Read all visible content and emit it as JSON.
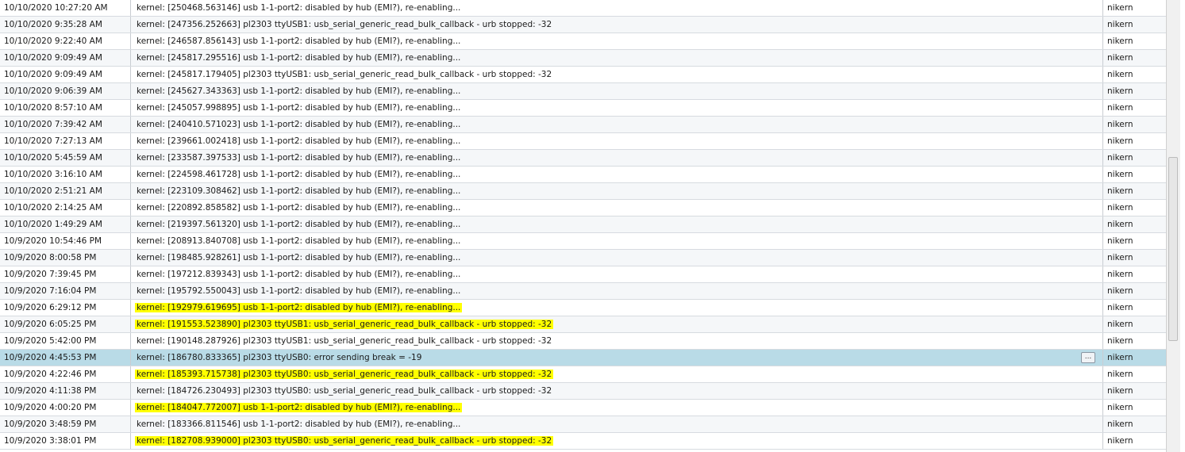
{
  "log": {
    "rows": [
      {
        "time": "10/10/2020 10:27:20 AM",
        "message": "kernel: [250468.563146] usb 1-1-port2: disabled by hub (EMI?), re-enabling...",
        "host": "nikern",
        "highlight": false
      },
      {
        "time": "10/10/2020 9:35:28 AM",
        "message": "kernel: [247356.252663] pl2303 ttyUSB1: usb_serial_generic_read_bulk_callback - urb stopped: -32",
        "host": "nikern",
        "highlight": false
      },
      {
        "time": "10/10/2020 9:22:40 AM",
        "message": "kernel: [246587.856143] usb 1-1-port2: disabled by hub (EMI?), re-enabling...",
        "host": "nikern",
        "highlight": false
      },
      {
        "time": "10/10/2020 9:09:49 AM",
        "message": "kernel: [245817.295516] usb 1-1-port2: disabled by hub (EMI?), re-enabling...",
        "host": "nikern",
        "highlight": false
      },
      {
        "time": "10/10/2020 9:09:49 AM",
        "message": "kernel: [245817.179405] pl2303 ttyUSB1: usb_serial_generic_read_bulk_callback - urb stopped: -32",
        "host": "nikern",
        "highlight": false
      },
      {
        "time": "10/10/2020 9:06:39 AM",
        "message": "kernel: [245627.343363] usb 1-1-port2: disabled by hub (EMI?), re-enabling...",
        "host": "nikern",
        "highlight": false
      },
      {
        "time": "10/10/2020 8:57:10 AM",
        "message": "kernel: [245057.998895] usb 1-1-port2: disabled by hub (EMI?), re-enabling...",
        "host": "nikern",
        "highlight": false
      },
      {
        "time": "10/10/2020 7:39:42 AM",
        "message": "kernel: [240410.571023] usb 1-1-port2: disabled by hub (EMI?), re-enabling...",
        "host": "nikern",
        "highlight": false
      },
      {
        "time": "10/10/2020 7:27:13 AM",
        "message": "kernel: [239661.002418] usb 1-1-port2: disabled by hub (EMI?), re-enabling...",
        "host": "nikern",
        "highlight": false
      },
      {
        "time": "10/10/2020 5:45:59 AM",
        "message": "kernel: [233587.397533] usb 1-1-port2: disabled by hub (EMI?), re-enabling...",
        "host": "nikern",
        "highlight": false
      },
      {
        "time": "10/10/2020 3:16:10 AM",
        "message": "kernel: [224598.461728] usb 1-1-port2: disabled by hub (EMI?), re-enabling...",
        "host": "nikern",
        "highlight": false
      },
      {
        "time": "10/10/2020 2:51:21 AM",
        "message": "kernel: [223109.308462] usb 1-1-port2: disabled by hub (EMI?), re-enabling...",
        "host": "nikern",
        "highlight": false
      },
      {
        "time": "10/10/2020 2:14:25 AM",
        "message": "kernel: [220892.858582] usb 1-1-port2: disabled by hub (EMI?), re-enabling...",
        "host": "nikern",
        "highlight": false
      },
      {
        "time": "10/10/2020 1:49:29 AM",
        "message": "kernel: [219397.561320] usb 1-1-port2: disabled by hub (EMI?), re-enabling...",
        "host": "nikern",
        "highlight": false
      },
      {
        "time": "10/9/2020 10:54:46 PM",
        "message": "kernel: [208913.840708] usb 1-1-port2: disabled by hub (EMI?), re-enabling...",
        "host": "nikern",
        "highlight": false
      },
      {
        "time": "10/9/2020 8:00:58 PM",
        "message": "kernel: [198485.928261] usb 1-1-port2: disabled by hub (EMI?), re-enabling...",
        "host": "nikern",
        "highlight": false
      },
      {
        "time": "10/9/2020 7:39:45 PM",
        "message": "kernel: [197212.839343] usb 1-1-port2: disabled by hub (EMI?), re-enabling...",
        "host": "nikern",
        "highlight": false
      },
      {
        "time": "10/9/2020 7:16:04 PM",
        "message": "kernel: [195792.550043] usb 1-1-port2: disabled by hub (EMI?), re-enabling...",
        "host": "nikern",
        "highlight": false
      },
      {
        "time": "10/9/2020 6:29:12 PM",
        "message": "kernel: [192979.619695] usb 1-1-port2: disabled by hub (EMI?), re-enabling...",
        "host": "nikern",
        "highlight": true
      },
      {
        "time": "10/9/2020 6:05:25 PM",
        "message": "kernel: [191553.523890] pl2303 ttyUSB1: usb_serial_generic_read_bulk_callback - urb stopped: -32",
        "host": "nikern",
        "highlight": true
      },
      {
        "time": "10/9/2020 5:42:00 PM",
        "message": "kernel: [190148.287926] pl2303 ttyUSB1: usb_serial_generic_read_bulk_callback - urb stopped: -32",
        "host": "nikern",
        "highlight": false
      },
      {
        "time": "10/9/2020 4:45:53 PM",
        "message": "kernel: [186780.833365] pl2303 ttyUSB0: error sending break = -19",
        "host": "nikern",
        "highlight": false,
        "selected": true
      },
      {
        "time": "10/9/2020 4:22:46 PM",
        "message": "kernel: [185393.715738] pl2303 ttyUSB0: usb_serial_generic_read_bulk_callback - urb stopped: -32",
        "host": "nikern",
        "highlight": true
      },
      {
        "time": "10/9/2020 4:11:38 PM",
        "message": "kernel: [184726.230493] pl2303 ttyUSB0: usb_serial_generic_read_bulk_callback - urb stopped: -32",
        "host": "nikern",
        "highlight": false
      },
      {
        "time": "10/9/2020 4:00:20 PM",
        "message": "kernel: [184047.772007] usb 1-1-port2: disabled by hub (EMI?), re-enabling...",
        "host": "nikern",
        "highlight": true
      },
      {
        "time": "10/9/2020 3:48:59 PM",
        "message": "kernel: [183366.811546] usb 1-1-port2: disabled by hub (EMI?), re-enabling...",
        "host": "nikern",
        "highlight": false
      },
      {
        "time": "10/9/2020 3:38:01 PM",
        "message": "kernel: [182708.939000] pl2303 ttyUSB0: usb_serial_generic_read_bulk_callback - urb stopped: -32",
        "host": "nikern",
        "highlight": true
      }
    ],
    "more_button_label": "..."
  },
  "colors": {
    "highlight": "#ffff00",
    "selected_row": "#b9dbe7",
    "grid_line": "#d7dbe0"
  }
}
